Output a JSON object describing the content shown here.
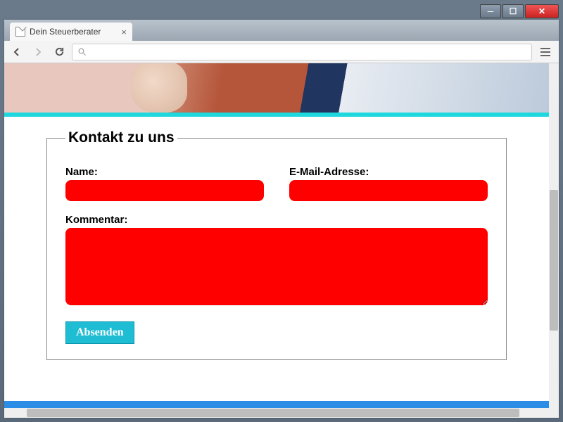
{
  "window": {
    "title": "Dein Steuerberater"
  },
  "browser": {
    "tab_title": "Dein Steuerberater",
    "url": ""
  },
  "page": {
    "fieldset_legend": "Kontakt zu uns",
    "name_label": "Name:",
    "email_label": "E-Mail-Adresse:",
    "comment_label": "Kommentar:",
    "name_value": "",
    "email_value": "",
    "comment_value": "",
    "submit_label": "Absenden"
  },
  "colors": {
    "accent_cyan": "#1fd8de",
    "button": "#1fbdd4",
    "field_bg": "#ff0000",
    "bottom_bar": "#2b8de6"
  }
}
